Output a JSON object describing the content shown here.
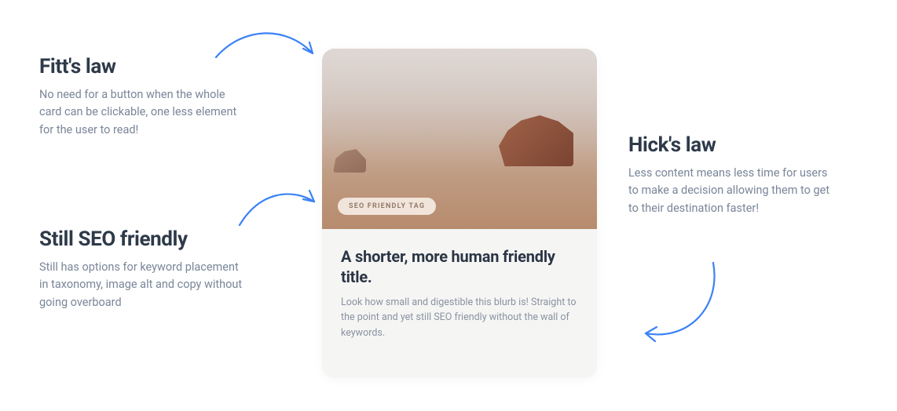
{
  "annotations": {
    "fitts": {
      "title": "Fitt's law",
      "body": "No need for a button when the whole card can be clickable, one less element for the user to read!"
    },
    "seo": {
      "title": "Still SEO  friendly",
      "body": "Still has options for keyword placement in taxonomy, image alt and copy without going overboard"
    },
    "hicks": {
      "title": "Hick's law",
      "body": "Less content means less time for users to make a decision allowing them to get to their destination faster!"
    }
  },
  "card": {
    "tag": "SEO FRIENDLY TAG",
    "title": "A shorter, more human friendly title.",
    "blurb": "Look how small and digestible this blurb is! Straight to the point and yet still SEO friendly without the wall of keywords."
  },
  "colors": {
    "arrow": "#3b82f6"
  }
}
